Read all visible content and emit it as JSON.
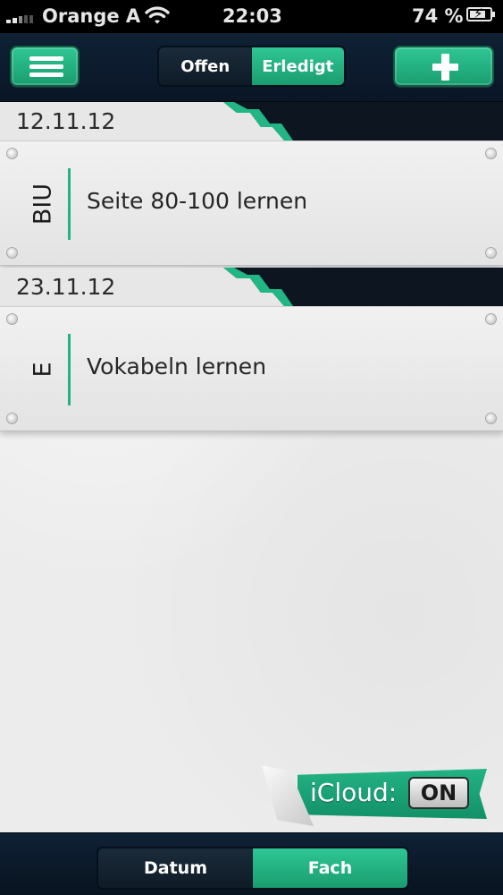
{
  "status_bar": {
    "carrier": "Orange A",
    "time": "22:03",
    "battery_percent": "74 %"
  },
  "toolbar": {
    "menu_icon": "hamburger-menu-icon",
    "filter": {
      "options": [
        "Offen",
        "Erledigt"
      ],
      "selected": "Erledigt"
    },
    "add_icon": "plus-icon"
  },
  "groups": [
    {
      "date": "12.11.12",
      "items": [
        {
          "subject": "BIU",
          "task": "Seite 80-100 lernen"
        }
      ]
    },
    {
      "date": "23.11.12",
      "items": [
        {
          "subject": "E",
          "task": "Vokabeln lernen"
        }
      ]
    }
  ],
  "icloud": {
    "label": "iCloud:",
    "state": "ON"
  },
  "sort_bar": {
    "options": [
      "Datum",
      "Fach"
    ],
    "selected": "Fach"
  },
  "colors": {
    "accent_green": "#21b684",
    "nav_dark_blue": "#0f2135"
  }
}
